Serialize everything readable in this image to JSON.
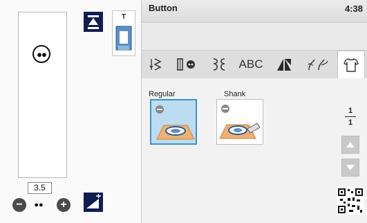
{
  "header": {
    "title": "Button",
    "time": "4:38"
  },
  "left_panel": {
    "foot_letter": "T",
    "width_value": "3.5",
    "minus_label": "−",
    "plus_label": "+"
  },
  "tabs": [
    {
      "icon": "stitch-zigzag-icon"
    },
    {
      "icon": "buttonhole-icon"
    },
    {
      "icon": "decorative-stitch-icon"
    },
    {
      "label": "ABC"
    },
    {
      "icon": "quilt-icon"
    },
    {
      "icon": "floral-icon"
    },
    {
      "icon": "garment-icon",
      "selected": true
    }
  ],
  "stitches": [
    {
      "label": "Regular",
      "selected": true
    },
    {
      "label": "Shank",
      "selected": false
    }
  ],
  "pager": {
    "current": "1",
    "total": "1"
  },
  "colors": {
    "accent": "#0f1e52",
    "selection": "#3b93c9",
    "foot_blue": "#5b8fc7",
    "fabric": "#f0b070"
  }
}
